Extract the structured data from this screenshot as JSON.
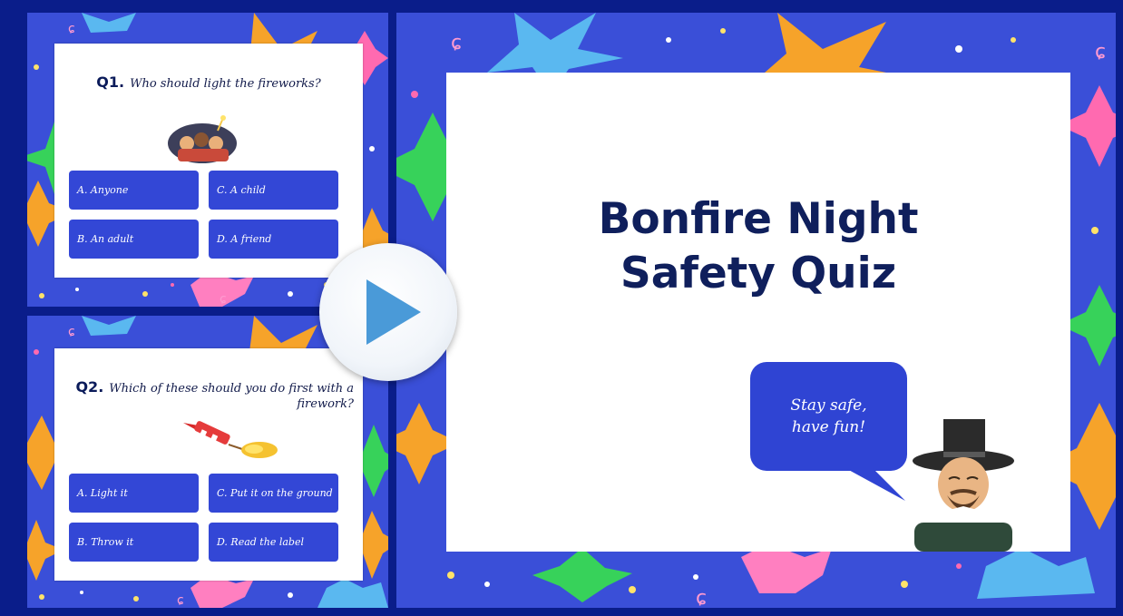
{
  "slides": {
    "q1": {
      "number": "Q1.",
      "question": "Who should light the fireworks?",
      "image_icon": "fireworks-crowd-icon",
      "answers": [
        {
          "label": "A. Anyone"
        },
        {
          "label": "C. A child"
        },
        {
          "label": "B. An adult"
        },
        {
          "label": "D. A friend"
        }
      ]
    },
    "q2": {
      "number": "Q2.",
      "question": "Which of these should you do first with a firework?",
      "image_icon": "rocket-firework-icon",
      "answers": [
        {
          "label": "A. Light it"
        },
        {
          "label": "C. Put it on the ground"
        },
        {
          "label": "B. Throw it"
        },
        {
          "label": "D. Read the label"
        }
      ]
    },
    "main": {
      "title_line1": "Bonfire Night",
      "title_line2": "Safety Quiz",
      "bubble_line1": "Stay safe,",
      "bubble_line2": "have fun!",
      "character_icon": "guy-fawkes-icon"
    }
  },
  "player": {
    "play_icon": "play-icon"
  },
  "colors": {
    "background": "#0a1d8a",
    "panel": "#3a4fd8",
    "answer_button": "#3347d6",
    "title_text": "#0f1f5c",
    "play_triangle": "#4a9ad8"
  }
}
